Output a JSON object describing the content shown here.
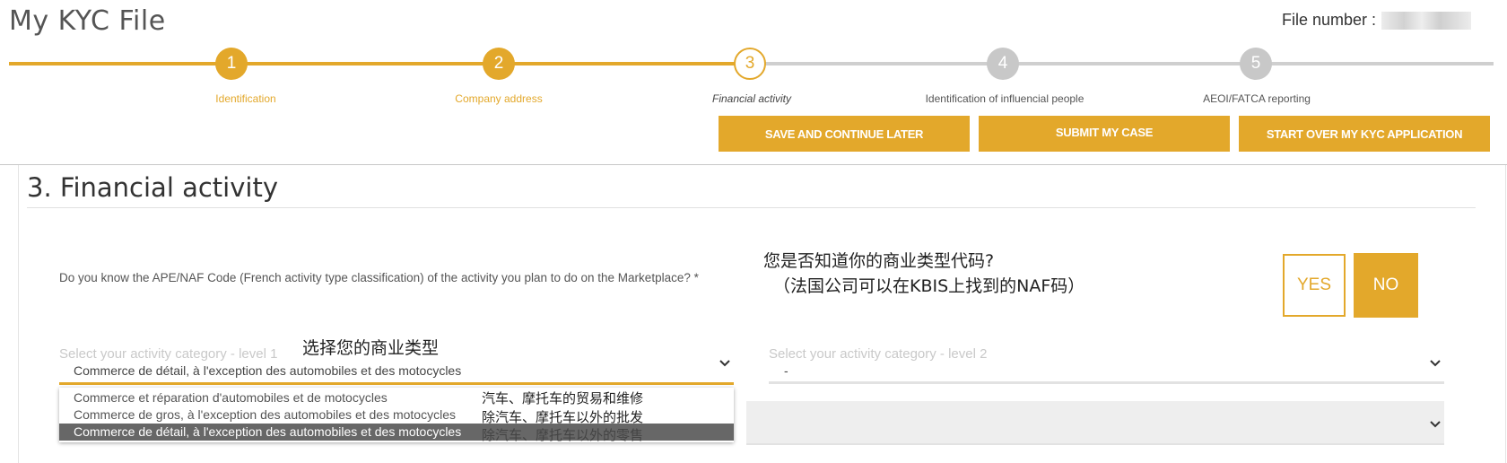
{
  "header": {
    "title": "My KYC File",
    "file_number_label": "File number :"
  },
  "steps": [
    {
      "number": "1",
      "label": "Identification",
      "state": "done"
    },
    {
      "number": "2",
      "label": "Company address",
      "state": "done"
    },
    {
      "number": "3",
      "label": "Financial activity",
      "state": "current"
    },
    {
      "number": "4",
      "label": "Identification of influencial people",
      "state": "todo"
    },
    {
      "number": "5",
      "label": "AEOI/FATCA reporting",
      "state": "todo"
    }
  ],
  "actions": {
    "save_later": "SAVE AND CONTINUE LATER",
    "submit": "SUBMIT MY CASE",
    "start_over": "START OVER MY KYC APPLICATION"
  },
  "section": {
    "title": "3. Financial activity",
    "question": "Do you know the APE/NAF Code (French activity type classification) of the activity you plan to do on the Marketplace? *",
    "question_note_line1": "您是否知道你的商业类型代码?",
    "question_note_line2": "（法国公司可以在KBIS上找到的NAF码）",
    "yes_label": "YES",
    "no_label": "NO"
  },
  "category_level1": {
    "label": "Select your activity category - level 1",
    "note": "选择您的商业类型",
    "value": "Commerce de détail, à l'exception des automobiles et des motocycles",
    "options": [
      {
        "label": "Commerce et réparation d'automobiles et de motocycles",
        "note": "汽车、摩托车的贸易和维修",
        "selected": false
      },
      {
        "label": "Commerce de gros, à l'exception des automobiles et des motocycles",
        "note": "除汽车、摩托车以外的批发",
        "selected": false
      },
      {
        "label": "Commerce de détail, à l'exception des automobiles et des motocycles",
        "note": "除汽车、摩托车以外的零售",
        "selected": true
      }
    ]
  },
  "category_level2": {
    "label": "Select your activity category - level 2",
    "value": "-"
  },
  "colors": {
    "accent": "#e3a82b",
    "inactive_step": "#c8c8c8",
    "selected_option": "#676767"
  },
  "icons": {
    "select_level1": "chevron-down-icon",
    "select_level2": "chevron-down-icon",
    "select_level3": "chevron-down-icon"
  }
}
